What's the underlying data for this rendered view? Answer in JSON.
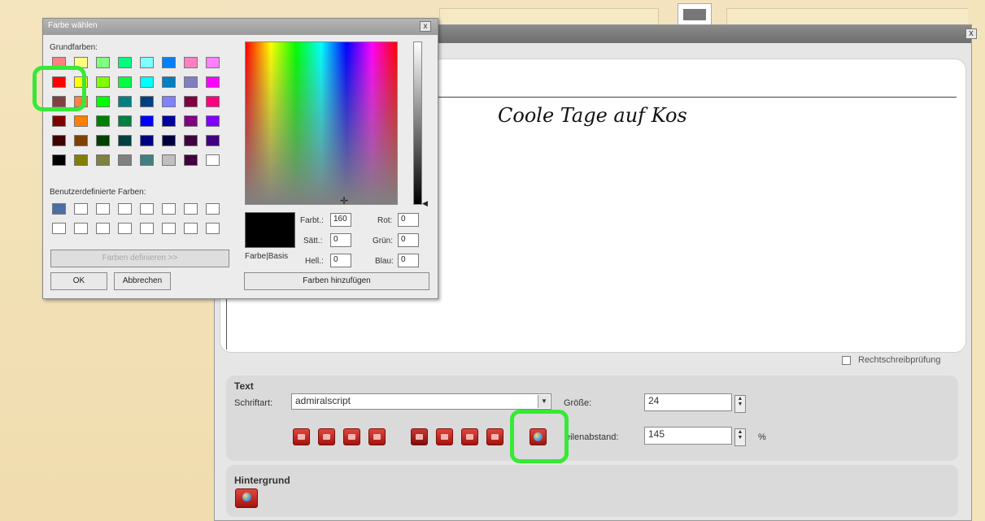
{
  "dialog": {
    "title": "Farbe wählen",
    "close_label": "x",
    "basic_colors_label": "Grundfarben:",
    "basic_colors": [
      [
        "#ff8080",
        "#ffff80",
        "#80ff80",
        "#00ff80",
        "#80ffff",
        "#0080ff",
        "#ff80c0",
        "#ff80ff"
      ],
      [
        "#ff0000",
        "#ffff00",
        "#80ff00",
        "#00ff40",
        "#00ffff",
        "#0080c0",
        "#8080c0",
        "#ff00ff"
      ],
      [
        "#804040",
        "#ff8040",
        "#00ff00",
        "#008080",
        "#004080",
        "#8080ff",
        "#800040",
        "#ff0080"
      ],
      [
        "#800000",
        "#ff8000",
        "#008000",
        "#008040",
        "#0000ff",
        "#0000a0",
        "#800080",
        "#8000ff"
      ],
      [
        "#400000",
        "#804000",
        "#004000",
        "#004040",
        "#000080",
        "#000040",
        "#400040",
        "#400080"
      ],
      [
        "#000000",
        "#808000",
        "#808040",
        "#808080",
        "#408080",
        "#c0c0c0",
        "#400040",
        "#ffffff"
      ]
    ],
    "custom_colors_label": "Benutzerdefinierte Farben:",
    "custom_colors": [
      [
        "#4a6fa5",
        "#ffffff",
        "#ffffff",
        "#ffffff",
        "#ffffff",
        "#ffffff",
        "#ffffff",
        "#ffffff"
      ],
      [
        "#ffffff",
        "#ffffff",
        "#ffffff",
        "#ffffff",
        "#ffffff",
        "#ffffff",
        "#ffffff",
        "#ffffff"
      ]
    ],
    "define_button": "Farben definieren >>",
    "ok_button": "OK",
    "cancel_button": "Abbrechen",
    "preview_label": "Farbe|Basis",
    "fields": {
      "hue_label": "Farbt.:",
      "hue": "160",
      "sat_label": "Sätt.:",
      "sat": "0",
      "lum_label": "Hell.:",
      "lum": "0",
      "red_label": "Rot:",
      "red": "0",
      "green_label": "Grün:",
      "green": "0",
      "blue_label": "Blau:",
      "blue": "0"
    },
    "add_button": "Farben hinzufügen"
  },
  "editor": {
    "close_label": "x",
    "sample_text": "Coole Tage auf Kos",
    "spellcheck_label": "Rechtschreibprüfung"
  },
  "text_panel": {
    "title": "Text",
    "font_label": "Schriftart:",
    "font_value": "admiralscript",
    "size_label": "Größe:",
    "size_value": "24",
    "spacing_label": "eilenabstand:",
    "spacing_value": "145",
    "spacing_unit": "%"
  },
  "background_panel": {
    "title": "Hintergrund"
  },
  "colors": {
    "highlight": "#36e936",
    "button_red": "#c0201a"
  }
}
